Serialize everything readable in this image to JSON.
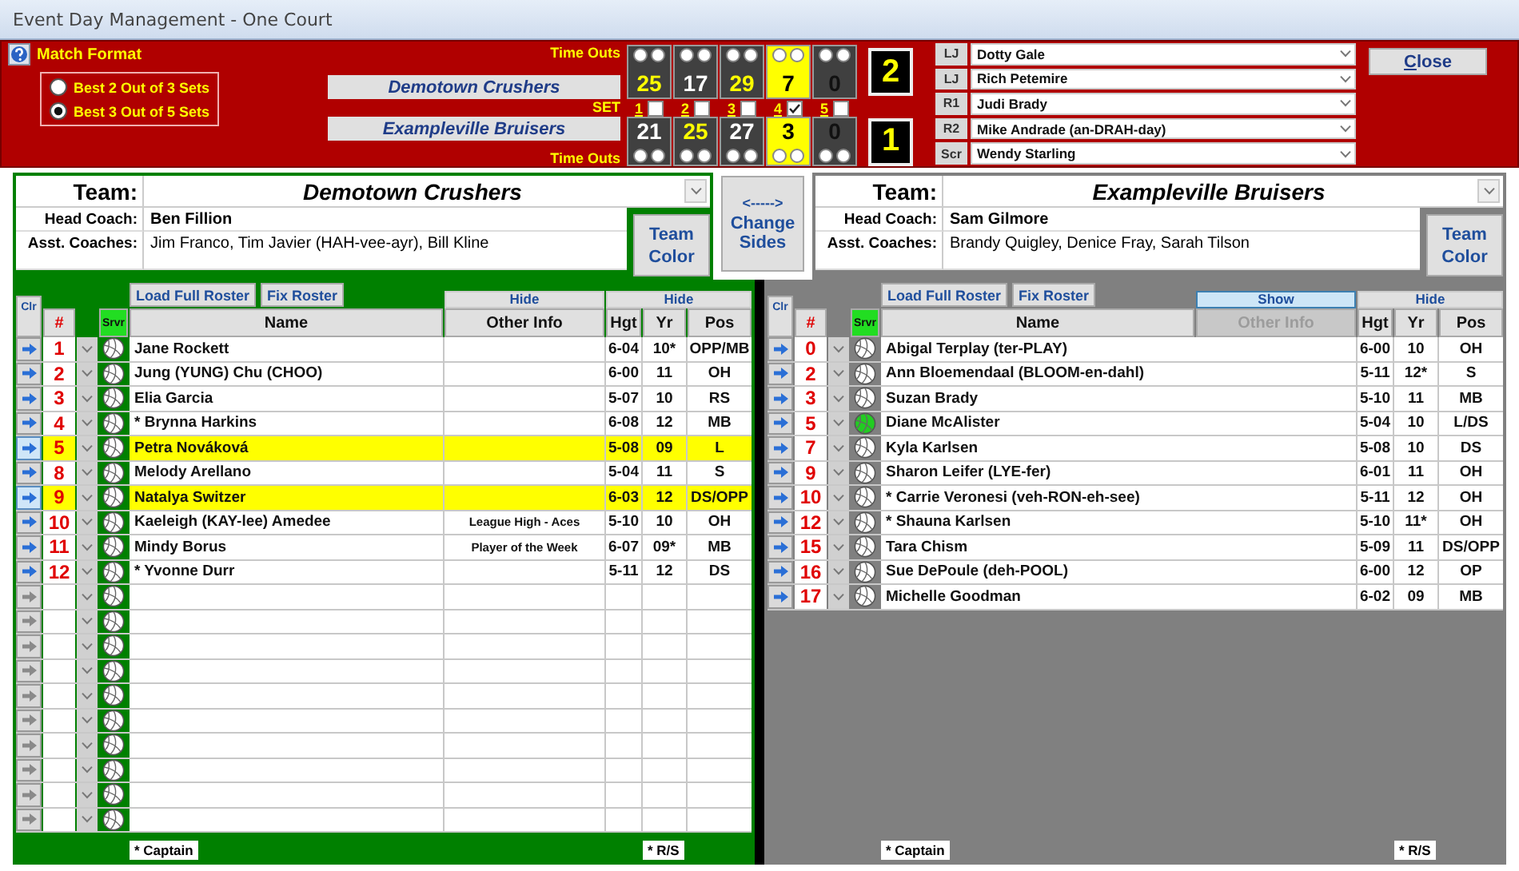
{
  "window": {
    "title": "Event Day Management - One Court"
  },
  "match_format": {
    "label": "Match Format",
    "options": [
      {
        "label": "Best 2 Out of 3 Sets",
        "selected": false
      },
      {
        "label": "Best 3 Out of 5 Sets",
        "selected": true
      }
    ]
  },
  "scoreboard": {
    "set_label": "SET",
    "sets": [
      {
        "label": "1",
        "checked": false
      },
      {
        "label": "2",
        "checked": false
      },
      {
        "label": "3",
        "checked": false
      },
      {
        "label": "4",
        "checked": true
      },
      {
        "label": "5",
        "checked": false
      }
    ],
    "teams": [
      {
        "name": "Demotown Crushers",
        "timeouts_label": "Time Outs",
        "sets_won": "2",
        "games": [
          {
            "score": "25",
            "current": false,
            "played": true,
            "won": true
          },
          {
            "score": "17",
            "current": false,
            "played": true,
            "won": false
          },
          {
            "score": "29",
            "current": false,
            "played": true,
            "won": true
          },
          {
            "score": "7",
            "current": true
          },
          {
            "score": "0",
            "current": false,
            "played": false
          }
        ]
      },
      {
        "name": "Exampleville Bruisers",
        "timeouts_label": "Time Outs",
        "sets_won": "1",
        "games": [
          {
            "score": "21",
            "current": false,
            "played": true,
            "won": false
          },
          {
            "score": "25",
            "current": false,
            "played": true,
            "won": true
          },
          {
            "score": "27",
            "current": false,
            "played": true,
            "won": false
          },
          {
            "score": "3",
            "current": true
          },
          {
            "score": "0",
            "current": false,
            "played": false
          }
        ]
      }
    ]
  },
  "officials": [
    {
      "role": "LJ",
      "name": "Dotty Gale"
    },
    {
      "role": "LJ",
      "name": "Rich Petemire"
    },
    {
      "role": "R1",
      "name": "Judi Brady"
    },
    {
      "role": "R2",
      "name": "Mike Andrade (an-DRAH-day)"
    },
    {
      "role": "Scr",
      "name": "Wendy Starling"
    }
  ],
  "close_button": "Close",
  "change_sides": {
    "arrow": "<----->",
    "label": "Change Sides"
  },
  "teams": [
    {
      "color": "#008000",
      "team_label": "Team:",
      "name": "Demotown Crushers",
      "head_coach_label": "Head Coach:",
      "head_coach": "Ben Fillion",
      "assistants_label": "Asst. Coaches:",
      "assistants": "Jim Franco, Tim Javier (HAH-vee-ayr), Bill Kline",
      "team_color_button": "Team Color",
      "load_roster_button": "Load Full Roster",
      "fix_roster_button": "Fix Roster",
      "other_info_visible": true,
      "other_info_toggle": "Hide",
      "stats_toggle": "Hide",
      "blank_rows": true,
      "columns": {
        "clear": "Clr",
        "number": "#",
        "server": "Srvr",
        "name": "Name",
        "other_info": "Other Info",
        "height": "Hgt",
        "year": "Yr",
        "position": "Pos"
      },
      "players": [
        {
          "number": "1",
          "name": "Jane Rockett",
          "height": "6-04",
          "year": "10*",
          "position": "OPP/MB",
          "highlighted": false,
          "serving": false
        },
        {
          "number": "2",
          "name": "Jung (YUNG) Chu (CHOO)",
          "height": "6-00",
          "year": "11",
          "position": "OH",
          "highlighted": false,
          "serving": false
        },
        {
          "number": "3",
          "name": "Elia Garcia",
          "height": "5-07",
          "year": "10",
          "position": "RS",
          "highlighted": false,
          "serving": false
        },
        {
          "number": "4",
          "name": "* Brynna Harkins",
          "height": "6-08",
          "year": "12",
          "position": "MB",
          "highlighted": false,
          "serving": false
        },
        {
          "number": "5",
          "name": "Petra Nováková",
          "height": "5-08",
          "year": "09",
          "position": "L",
          "highlighted": true,
          "serving": false
        },
        {
          "number": "8",
          "name": "Melody Arellano",
          "height": "5-04",
          "year": "11",
          "position": "S",
          "highlighted": false,
          "serving": false
        },
        {
          "number": "9",
          "name": "Natalya Switzer",
          "height": "6-03",
          "year": "12",
          "position": "DS/OPP",
          "highlighted": true,
          "serving": false
        },
        {
          "number": "10",
          "name": "Kaeleigh (KAY-lee) Amedee",
          "other_info": "League High - Aces",
          "height": "5-10",
          "year": "10",
          "position": "OH",
          "highlighted": false,
          "serving": false
        },
        {
          "number": "11",
          "name": "Mindy Borus",
          "other_info": "Player of the Week",
          "height": "6-07",
          "year": "09*",
          "position": "MB",
          "highlighted": false,
          "serving": false
        },
        {
          "number": "12",
          "name": "* Yvonne Durr",
          "height": "5-11",
          "year": "12",
          "position": "DS",
          "highlighted": false,
          "serving": false
        }
      ],
      "captain_note": "* Captain",
      "rs_note": "* R/S"
    },
    {
      "color": "#808080",
      "team_label": "Team:",
      "name": "Exampleville Bruisers",
      "head_coach_label": "Head Coach:",
      "head_coach": "Sam Gilmore",
      "assistants_label": "Asst. Coaches:",
      "assistants": "Brandy Quigley, Denice Fray, Sarah Tilson",
      "team_color_button": "Team Color",
      "load_roster_button": "Load Full Roster",
      "fix_roster_button": "Fix Roster",
      "other_info_visible": false,
      "other_info_toggle": "Show",
      "stats_toggle": "Hide",
      "blank_rows": false,
      "columns": {
        "clear": "Clr",
        "number": "#",
        "server": "Srvr",
        "name": "Name",
        "other_info": "Other Info",
        "height": "Hgt",
        "year": "Yr",
        "position": "Pos"
      },
      "players": [
        {
          "number": "0",
          "name": "Abigal Terplay (ter-PLAY)",
          "height": "6-00",
          "year": "10",
          "position": "OH",
          "highlighted": false,
          "serving": false
        },
        {
          "number": "2",
          "name": "Ann Bloemendaal (BLOOM-en-dahl)",
          "height": "5-11",
          "year": "12*",
          "position": "S",
          "highlighted": false,
          "serving": false
        },
        {
          "number": "3",
          "name": "Suzan Brady",
          "height": "5-10",
          "year": "11",
          "position": "MB",
          "highlighted": false,
          "serving": false
        },
        {
          "number": "5",
          "name": "Diane McAlister",
          "height": "5-04",
          "year": "10",
          "position": "L/DS",
          "highlighted": false,
          "serving": true
        },
        {
          "number": "7",
          "name": "Kyla Karlsen",
          "height": "5-08",
          "year": "10",
          "position": "DS",
          "highlighted": false,
          "serving": false
        },
        {
          "number": "9",
          "name": "Sharon Leifer (LYE-fer)",
          "height": "6-01",
          "year": "11",
          "position": "OH",
          "highlighted": false,
          "serving": false
        },
        {
          "number": "10",
          "name": "* Carrie Veronesi (veh-RON-eh-see)",
          "height": "5-11",
          "year": "12",
          "position": "OH",
          "highlighted": false,
          "serving": false
        },
        {
          "number": "12",
          "name": "* Shauna Karlsen",
          "height": "5-10",
          "year": "11*",
          "position": "OH",
          "highlighted": false,
          "serving": false
        },
        {
          "number": "15",
          "name": "Tara Chism",
          "height": "5-09",
          "year": "11",
          "position": "DS/OPP",
          "highlighted": false,
          "serving": false
        },
        {
          "number": "16",
          "name": "Sue DePoule (deh-POOL)",
          "height": "6-00",
          "year": "12",
          "position": "OP",
          "highlighted": false,
          "serving": false
        },
        {
          "number": "17",
          "name": "Michelle Goodman",
          "height": "6-02",
          "year": "09",
          "position": "MB",
          "highlighted": false,
          "serving": false
        }
      ],
      "captain_note": "* Captain",
      "rs_note": "* R/S"
    }
  ]
}
